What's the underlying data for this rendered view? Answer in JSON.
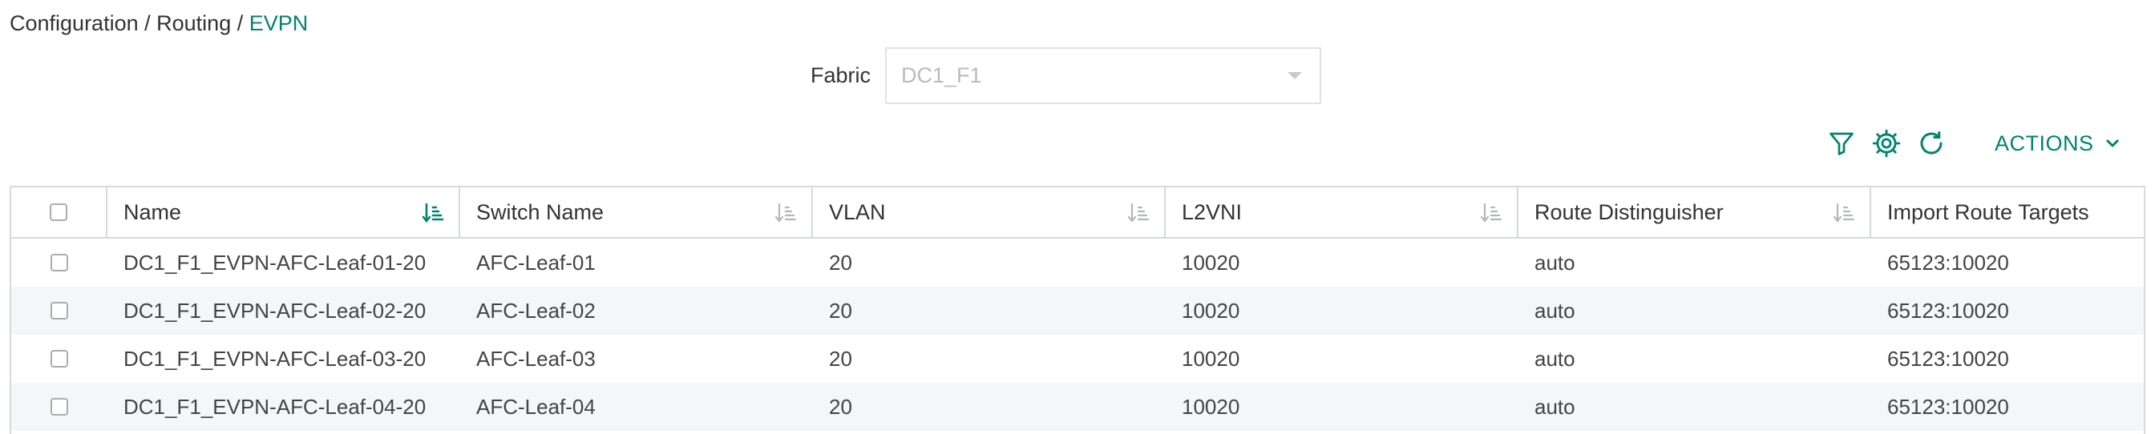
{
  "breadcrumb": {
    "items": [
      "Configuration",
      "Routing",
      "EVPN"
    ],
    "separator": "/"
  },
  "fabric": {
    "label": "Fabric",
    "value": "DC1_F1"
  },
  "toolbar": {
    "actions_label": "ACTIONS",
    "icons": [
      "filter-icon",
      "gear-icon",
      "refresh-icon",
      "chevron-down-icon"
    ]
  },
  "colors": {
    "accent": "#01846f",
    "border": "#d7d9dc",
    "row_alt": "#f5f6f8"
  },
  "table": {
    "columns": [
      "Name",
      "Switch Name",
      "VLAN",
      "L2VNI",
      "Route Distinguisher",
      "Import Route Targets"
    ],
    "rows": [
      {
        "name": "DC1_F1_EVPN-AFC-Leaf-01-20",
        "switch": "AFC-Leaf-01",
        "vlan": "20",
        "l2vni": "10020",
        "rd": "auto",
        "irt": "65123:10020"
      },
      {
        "name": "DC1_F1_EVPN-AFC-Leaf-02-20",
        "switch": "AFC-Leaf-02",
        "vlan": "20",
        "l2vni": "10020",
        "rd": "auto",
        "irt": "65123:10020"
      },
      {
        "name": "DC1_F1_EVPN-AFC-Leaf-03-20",
        "switch": "AFC-Leaf-03",
        "vlan": "20",
        "l2vni": "10020",
        "rd": "auto",
        "irt": "65123:10020"
      },
      {
        "name": "DC1_F1_EVPN-AFC-Leaf-04-20",
        "switch": "AFC-Leaf-04",
        "vlan": "20",
        "l2vni": "10020",
        "rd": "auto",
        "irt": "65123:10020"
      }
    ]
  }
}
